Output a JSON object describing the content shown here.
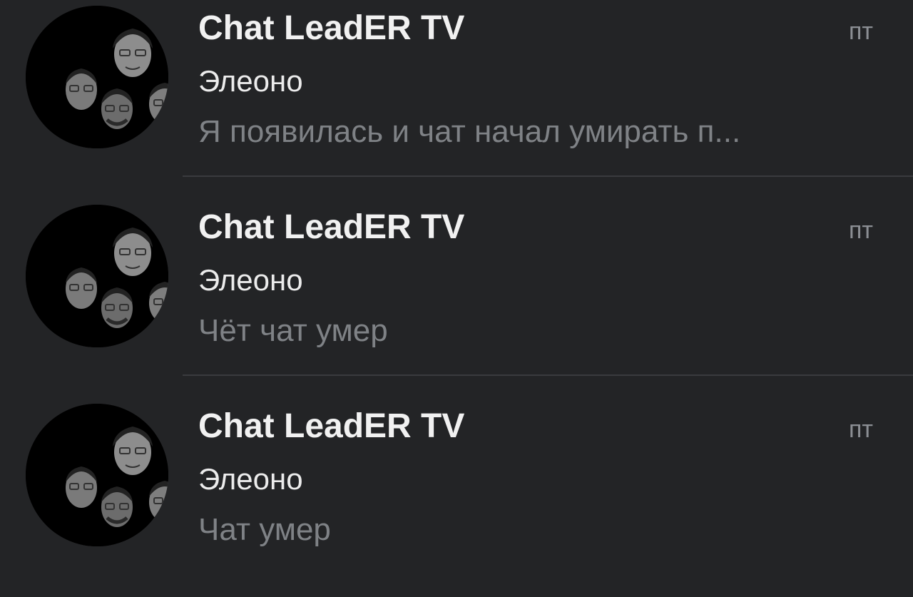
{
  "chats": [
    {
      "title": "Chat LeadER TV",
      "time": "пт",
      "sender": "Элеоно",
      "preview": "Я появилась и чат начал умирать п...",
      "avatar_icon": "group-faces-avatar"
    },
    {
      "title": "Chat LeadER TV",
      "time": "пт",
      "sender": "Элеоно",
      "preview": "Чёт чат умер",
      "avatar_icon": "group-faces-avatar"
    },
    {
      "title": "Chat LeadER TV",
      "time": "пт",
      "sender": "Элеоно",
      "preview": "Чат умер",
      "avatar_icon": "group-faces-avatar"
    }
  ],
  "colors": {
    "background": "#232426",
    "title": "#f1f1f1",
    "sender": "#ececec",
    "preview": "#7f8286",
    "time": "#8c8f94",
    "divider": "#3a3b3e"
  }
}
